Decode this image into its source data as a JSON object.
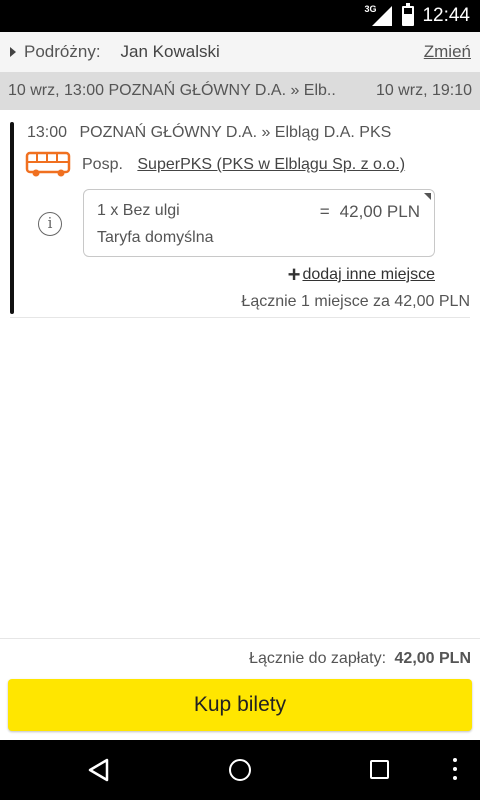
{
  "status_bar": {
    "time": "12:44",
    "network": "3G",
    "icons": [
      "signal-icon",
      "battery-icon"
    ]
  },
  "passenger": {
    "label": "Podróżny:",
    "name": "Jan Kowalski",
    "change_label": "Zmień"
  },
  "route_summary": {
    "departure": "10 wrz, 13:00 POZNAŃ GŁÓWNY D.A. » Elb..",
    "arrival": "10 wrz, 19:10"
  },
  "segment": {
    "time": "13:00",
    "route": "POZNAŃ GŁÓWNY D.A. » Elbląg D.A. PKS",
    "carrier_type": "Posp.",
    "carrier_name": "SuperPKS (PKS w Elblągu Sp. z o.o.)",
    "fare": {
      "passenger_type": "1 x Bez ulgi",
      "equals": "=",
      "price": "42,00 PLN",
      "tariff": "Taryfa domyślna"
    },
    "add_seat_label": "dodaj inne miejsce",
    "segment_total": "Łącznie 1 miejsce za 42,00 PLN"
  },
  "summary": {
    "total_label": "Łącznie do zapłaty:",
    "total_value": "42,00 PLN"
  },
  "buy_button_label": "Kup bilety",
  "colors": {
    "accent_yellow": "#ffe600",
    "bus_orange": "#f07020",
    "route_bar_gray": "#dcdcdc"
  }
}
